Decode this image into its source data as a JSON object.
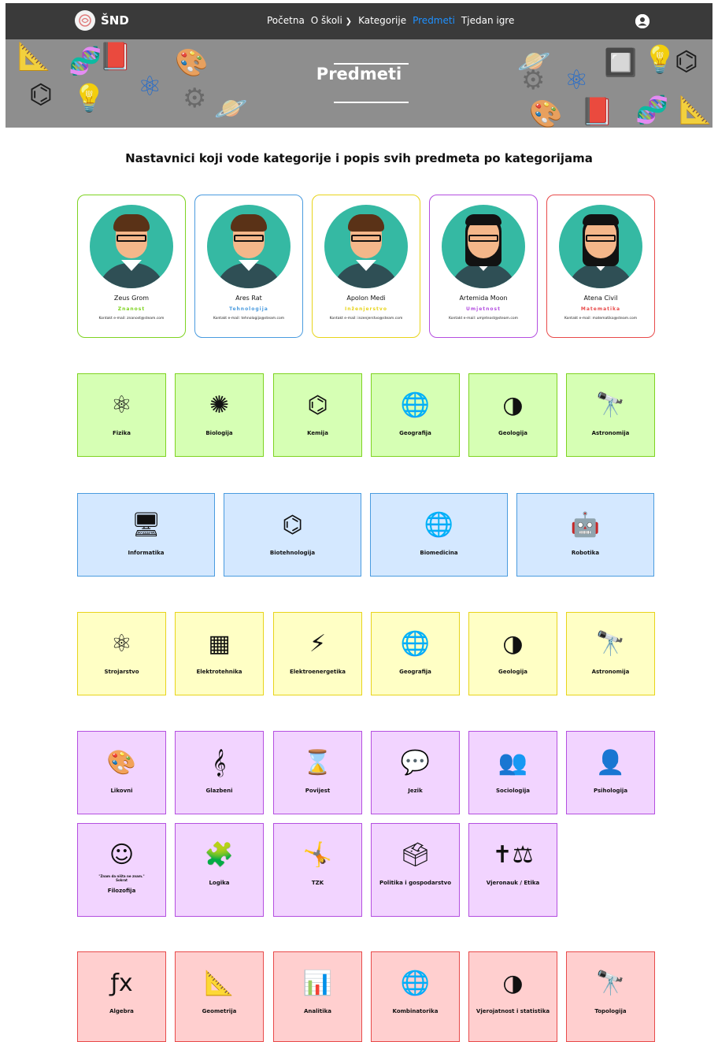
{
  "brand": {
    "name": "ŠND",
    "logo_icon": "brain-icon"
  },
  "nav": {
    "items": [
      "Početna",
      "O školi",
      "Kategorije",
      "Predmeti",
      "Tjedan igre"
    ],
    "active": "Predmeti",
    "dropdown_icon": "chevron-down-icon",
    "user_icon": "user-circle-icon"
  },
  "hero": {
    "title": "Predmeti"
  },
  "page": {
    "heading": "Nastavnici koji vode kategorije i popis svih predmeta po kategorijama"
  },
  "colors": {
    "znanost": "#7ed321",
    "tehnologija": "#4a9bdf",
    "inzenjerstvo": "#e8d41b",
    "umjetnost": "#b44fe0",
    "matematika": "#e84a4a",
    "nav_bg": "#3a3a3a",
    "active_link": "#1e90ff"
  },
  "teachers": [
    {
      "name": "Zeus Grom",
      "category": "Znanost",
      "email": "Kontakt e-mail: znanost@steam.com",
      "gender": "m"
    },
    {
      "name": "Ares Rat",
      "category": "Tehnologija",
      "email": "Kontakt e-mail: tehnologija@steam.com",
      "gender": "m"
    },
    {
      "name": "Apolon Medi",
      "category": "Inženjerstvo",
      "email": "Kontakt e-mail: inzenjerstvo@steam.com",
      "gender": "m"
    },
    {
      "name": "Artemida Moon",
      "category": "Umjetnost",
      "email": "Kontakt e-mail: umjetnost@steam.com",
      "gender": "f"
    },
    {
      "name": "Atena Civil",
      "category": "Matematika",
      "email": "Kontakt e-mail: matematika@steam.com",
      "gender": "f"
    }
  ],
  "subjects": {
    "znanost": [
      {
        "label": "Fizika",
        "icon": "atom-icon",
        "glyph": "⚛"
      },
      {
        "label": "Biologija",
        "icon": "neuron-icon",
        "glyph": "✺"
      },
      {
        "label": "Kemija",
        "icon": "molecule-icon",
        "glyph": "⌬"
      },
      {
        "label": "Geografija",
        "icon": "globe-icon",
        "glyph": "🌐"
      },
      {
        "label": "Geologija",
        "icon": "earth-layers-icon",
        "glyph": "◑"
      },
      {
        "label": "Astronomija",
        "icon": "telescope-icon",
        "glyph": "🔭"
      }
    ],
    "tehnologija": [
      {
        "label": "Informatika",
        "icon": "computer-icon",
        "glyph": "🖥"
      },
      {
        "label": "Biotehnologija",
        "icon": "molecule-icon",
        "glyph": "⌬"
      },
      {
        "label": "Biomedicina",
        "icon": "globe-icon",
        "glyph": "🌐"
      },
      {
        "label": "Robotika",
        "icon": "robot-icon",
        "glyph": "🤖"
      }
    ],
    "inzenjerstvo": [
      {
        "label": "Strojarstvo",
        "icon": "atom-icon",
        "glyph": "⚛"
      },
      {
        "label": "Elektrotehnika",
        "icon": "chip-icon",
        "glyph": "▦"
      },
      {
        "label": "Elektroenergetika",
        "icon": "power-tower-icon",
        "glyph": "⚡"
      },
      {
        "label": "Geografija",
        "icon": "globe-icon",
        "glyph": "🌐"
      },
      {
        "label": "Geologija",
        "icon": "earth-layers-icon",
        "glyph": "◑"
      },
      {
        "label": "Astronomija",
        "icon": "telescope-icon",
        "glyph": "🔭"
      }
    ],
    "umjetnost": [
      {
        "label": "Likovni",
        "icon": "palette-icon",
        "glyph": "🎨"
      },
      {
        "label": "Glazbeni",
        "icon": "music-notes-icon",
        "glyph": "𝄞"
      },
      {
        "label": "Povijest",
        "icon": "hourglass-icon",
        "glyph": "⌛"
      },
      {
        "label": "Jezik",
        "icon": "translate-icon",
        "glyph": "💬"
      },
      {
        "label": "Sociologija",
        "icon": "people-icon",
        "glyph": "👥"
      },
      {
        "label": "Psihologija",
        "icon": "head-brain-icon",
        "glyph": "👤"
      },
      {
        "label": "Filozofija",
        "icon": "socrates-icon",
        "glyph": "☺",
        "quote": "\"Znam da ništa ne znam.\"",
        "author": "Sokrat"
      },
      {
        "label": "Logika",
        "icon": "head-puzzle-icon",
        "glyph": "🧩"
      },
      {
        "label": "TZK",
        "icon": "athletes-icon",
        "glyph": "🤸"
      },
      {
        "label": "Politika i gospodarstvo",
        "icon": "ballot-box-icon",
        "glyph": "🗳"
      },
      {
        "label": "Vjeronauk / Etika",
        "icon": "cross-scales-icon",
        "glyph": "✝⚖"
      }
    ],
    "matematika": [
      {
        "label": "Algebra",
        "icon": "function-icon",
        "glyph": "ƒx"
      },
      {
        "label": "Geometrija",
        "icon": "geometry-tools-icon",
        "glyph": "📐"
      },
      {
        "label": "Analitika",
        "icon": "bar-chart-icon",
        "glyph": "📊"
      },
      {
        "label": "Kombinatorika",
        "icon": "globe-icon",
        "glyph": "🌐"
      },
      {
        "label": "Vjerojatnost i statistika",
        "icon": "earth-layers-icon",
        "glyph": "◑"
      },
      {
        "label": "Topologija",
        "icon": "telescope-icon",
        "glyph": "🔭"
      }
    ]
  }
}
